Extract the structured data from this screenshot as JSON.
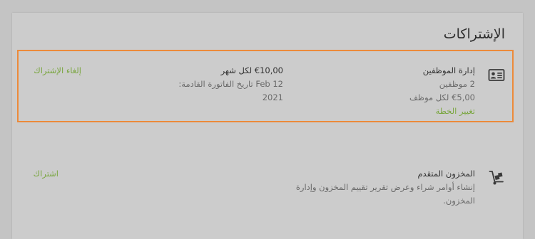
{
  "page": {
    "title": "الإشتراكات"
  },
  "subscriptions": [
    {
      "name": "إدارة الموظفين",
      "detail1": "2 موظفين",
      "detail2": "€5,00 لكل موظف",
      "link": "تغيير الخطة",
      "price": "€10,00 لكل شهر",
      "next_invoice_label": "تاريخ الفاتورة القادمة:",
      "next_invoice_date": "Feb 12",
      "next_invoice_year": "2021",
      "action": "إلغاء الإشتراك",
      "icon": "contact-card-icon"
    },
    {
      "name": "المخزون المتقدم",
      "description_line1": "إنشاء أوامر شراء وعرض تقرير تقييم المخزون وإدارة",
      "description_line2": "المخزون.",
      "action": "اشتراك",
      "icon": "hand-truck-icon"
    }
  ],
  "colors": {
    "accent_green": "#7aa640",
    "highlight_orange": "#ec8a3a"
  }
}
